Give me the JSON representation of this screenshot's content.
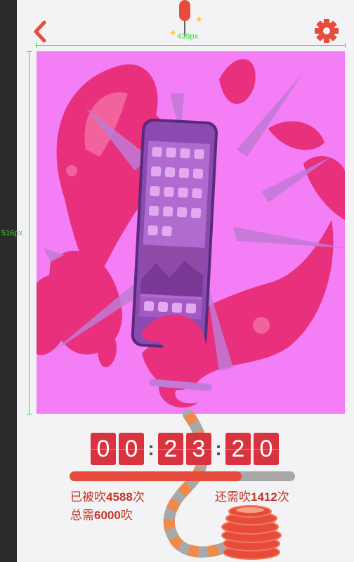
{
  "header": {
    "back_icon": "chevron-left-icon",
    "settings_icon": "gear-icon",
    "accent_color": "#e74c3c"
  },
  "guides": {
    "width_label": "439px",
    "height_label": "516px",
    "color": "#3ed33e"
  },
  "stage": {
    "background": "#f47ef5",
    "image": "phone-burst-illustration"
  },
  "countdown": {
    "digits": [
      "0",
      "0",
      "2",
      "3",
      "2",
      "0"
    ],
    "separator": ":",
    "color": "#d8333f"
  },
  "progress": {
    "value": 4588,
    "total": 6000,
    "fill_color": "#e64b3c",
    "track_color": "#a8a8a8"
  },
  "stats": {
    "blown_prefix": "已被吹",
    "blown_count": "4588",
    "blown_suffix": "次",
    "remaining_prefix": "还需吹",
    "remaining_count": "1412",
    "remaining_suffix": "次",
    "total_prefix": "总需",
    "total_count": "6000",
    "total_suffix": "吹"
  }
}
